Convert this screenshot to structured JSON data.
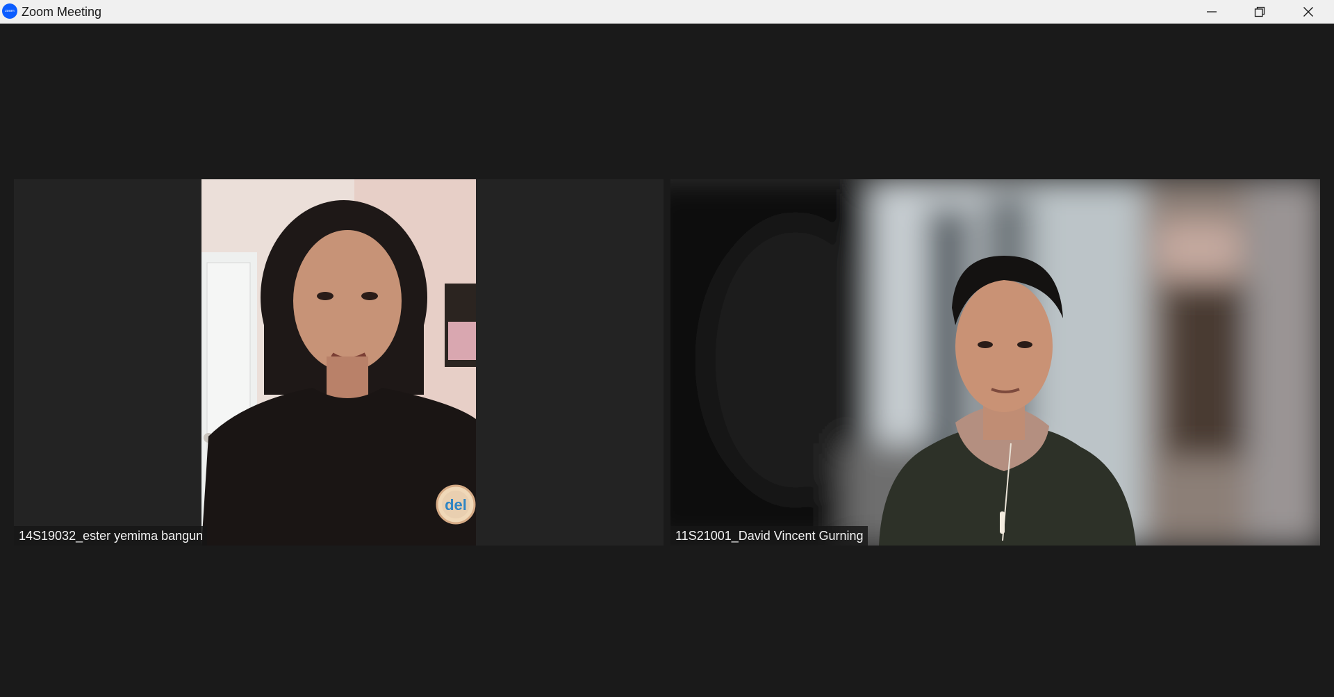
{
  "window": {
    "title": "Zoom Meeting",
    "logo_text": "zoom",
    "controls": {
      "minimize_icon": "minimize-icon",
      "maximize_icon": "restore-icon",
      "close_icon": "close-icon"
    }
  },
  "participants": [
    {
      "name": "14S19032_ester yemima bangun",
      "badge_text": "del"
    },
    {
      "name": "11S21001_David Vincent Gurning"
    }
  ],
  "colors": {
    "titlebar_bg": "#f0f0f0",
    "stage_bg": "#1a1a1a",
    "tile_bg": "#232323",
    "logo_blue": "#0b5cff"
  }
}
